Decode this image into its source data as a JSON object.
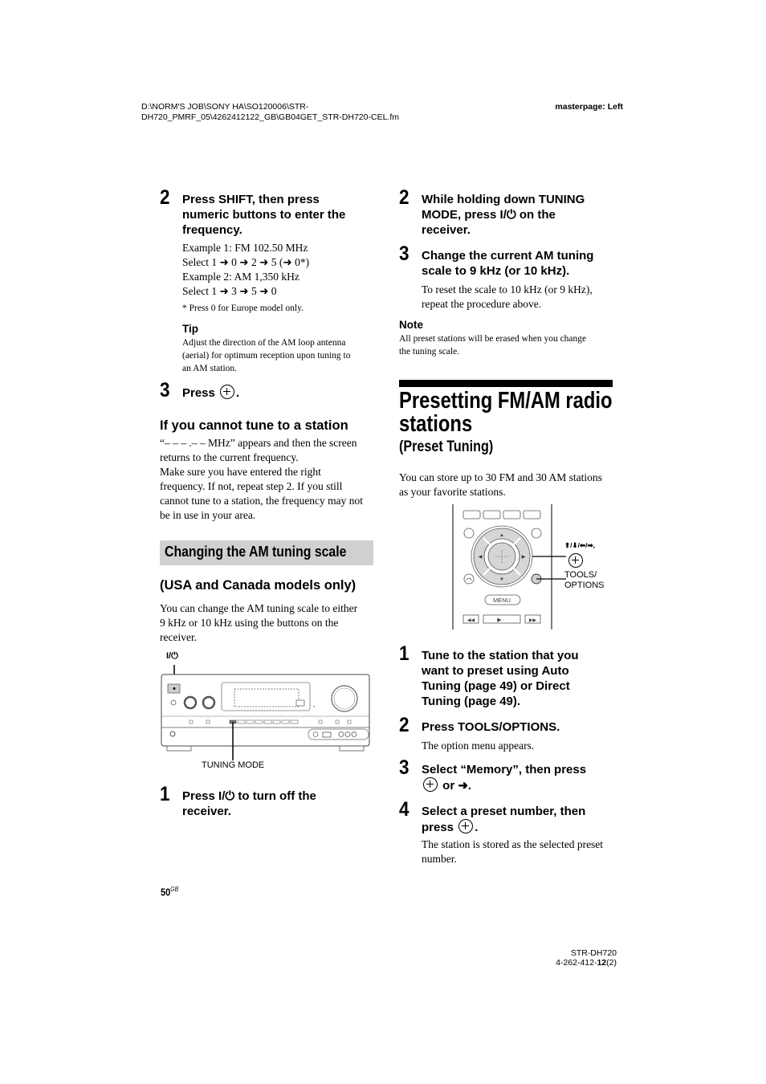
{
  "header": {
    "path_line1": "D:\\NORM'S JOB\\SONY HA\\SO120006\\STR-",
    "path_line2": "DH720_PMRF_05\\4262412122_GB\\GB04GET_STR-DH720-CEL.fm",
    "masterpage": "masterpage: Left"
  },
  "left_column": {
    "step2": {
      "number": "2",
      "title_lines": [
        "Press SHIFT, then press",
        "numeric buttons to enter the",
        "frequency."
      ],
      "example_lines": [
        "Example 1: FM 102.50 MHz",
        "Select 1 ➜ 0 ➜ 2 ➜ 5 (➜ 0*)",
        "Example 2: AM 1,350 kHz",
        "Select 1 ➜ 3 ➜ 5 ➜ 0"
      ],
      "footnote": "* Press 0 for Europe model only."
    },
    "tip": {
      "label": "Tip",
      "lines": [
        "Adjust the direction of the AM loop antenna",
        "(aerial) for optimum reception upon tuning to",
        "an AM station."
      ]
    },
    "step3": {
      "number": "3",
      "prefix": "Press",
      "suffix": ".",
      "icon": "enter-icon"
    },
    "cannot_tune": {
      "heading": "If you cannot tune to a station",
      "lines": [
        "“– – – .– – MHz” appears and then the screen",
        "returns to the current frequency.",
        "Make sure you have entered the right",
        "frequency. If not, repeat step 2. If you still",
        "cannot tune to a station, the frequency may not",
        "be in use in your area."
      ]
    },
    "section_title": "Changing the AM tuning scale",
    "models_note": "(USA and Canada models only)",
    "intro_lines": [
      "You can change the AM tuning scale to either",
      "9 kHz or 10 kHz using the buttons on the",
      "receiver."
    ],
    "figure": {
      "power_label": "I/⏻",
      "tuning_mode_label": "TUNING MODE"
    },
    "step1": {
      "number": "1",
      "title_lines": [
        "Press I/⏻ to turn off the",
        "receiver."
      ]
    },
    "page_number": "50",
    "page_suffix": "GB"
  },
  "right_column": {
    "step2": {
      "number": "2",
      "title_lines": [
        "While holding down TUNING",
        "MODE, press I/⏻ on the",
        "receiver."
      ]
    },
    "step3": {
      "number": "3",
      "title_lines": [
        "Change the current AM tuning",
        "scale to 9 kHz (or 10 kHz)."
      ],
      "body_lines": [
        "To reset the scale to 10 kHz (or 9 kHz),",
        "repeat the procedure above."
      ]
    },
    "note": {
      "label": "Note",
      "lines": [
        "All preset stations will be erased when you change",
        "the tuning scale."
      ]
    },
    "title_lines": [
      "Presetting FM/AM radio",
      "stations"
    ],
    "subtitle": "(Preset Tuning)",
    "intro_lines": [
      "You can store up to 30 FM and 30 AM stations",
      "as your favorite stations."
    ],
    "remote_figure": {
      "arrows_label": "⬆/⬇/⬅/➡,",
      "tools_label_line1": "TOOLS/",
      "tools_label_line2": "OPTIONS",
      "menu_label": "MENU"
    },
    "steps": [
      {
        "number": "1",
        "title_lines": [
          "Tune to the station that you",
          "want to preset using Auto",
          "Tuning (page 49) or Direct",
          "Tuning (page 49)."
        ]
      },
      {
        "number": "2",
        "title_lines": [
          "Press TOOLS/OPTIONS."
        ],
        "body": "The option menu appears."
      },
      {
        "number": "3",
        "line1": "Select “Memory”, then press",
        "line2_mid": "or",
        "line2_end": "➜."
      },
      {
        "number": "4",
        "line1": "Select a preset number, then",
        "line2_prefix": "press",
        "line2_end": ".",
        "body_lines": [
          "The station is stored as the selected preset",
          "number."
        ]
      }
    ]
  },
  "footer": {
    "model": "STR-DH720",
    "code_prefix": "4-262-412-",
    "code_bold": "12",
    "code_suffix": "(2)"
  }
}
